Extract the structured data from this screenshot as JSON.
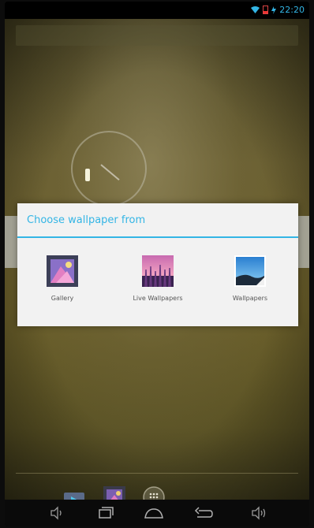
{
  "status_bar": {
    "time": "22:20"
  },
  "dialog": {
    "title": "Choose wallpaper from",
    "options": [
      {
        "label": "Gallery",
        "icon": "gallery-icon"
      },
      {
        "label": "Live Wallpapers",
        "icon": "live-wallpapers-icon"
      },
      {
        "label": "Wallpapers",
        "icon": "wallpapers-icon"
      }
    ]
  },
  "dock": {
    "icons": [
      "play-store-icon",
      "gallery-icon",
      "app-drawer-icon"
    ]
  },
  "navigation": {
    "buttons": [
      "volume-down-icon",
      "recent-apps-icon",
      "home-icon",
      "back-icon",
      "volume-up-icon"
    ]
  },
  "colors": {
    "accent": "#33b5e5",
    "dialog_background": "#f2f2f2",
    "wallpaper": "#6a5f30"
  }
}
